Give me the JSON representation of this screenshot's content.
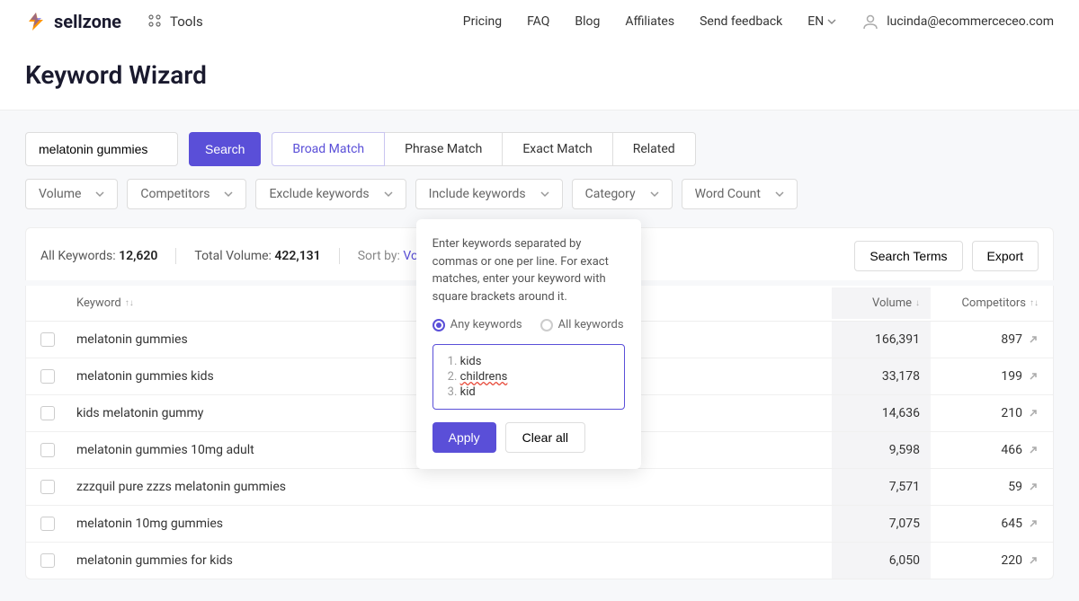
{
  "header": {
    "brand": "sellzone",
    "tools_label": "Tools",
    "nav": [
      "Pricing",
      "FAQ",
      "Blog",
      "Affiliates",
      "Send feedback"
    ],
    "lang": "EN",
    "user_email": "lucinda@ecommerceceo.com"
  },
  "page_title": "Keyword Wizard",
  "search": {
    "value": "melatonin gummies",
    "button": "Search"
  },
  "match_tabs": [
    "Broad Match",
    "Phrase Match",
    "Exact Match",
    "Related"
  ],
  "filters": {
    "volume": "Volume",
    "competitors": "Competitors",
    "exclude": "Exclude keywords",
    "include": "Include keywords",
    "category": "Category",
    "wordcount": "Word Count"
  },
  "stats": {
    "all_keywords_label": "All Keywords:",
    "all_keywords_value": "12,620",
    "total_volume_label": "Total Volume:",
    "total_volume_value": "422,131",
    "sortby_label": "Sort by:",
    "sortby_value": "Volum"
  },
  "actions": {
    "search_terms": "Search Terms",
    "export": "Export"
  },
  "table": {
    "headers": {
      "keyword": "Keyword",
      "volume": "Volume",
      "competitors": "Competitors"
    },
    "rows": [
      {
        "keyword": "melatonin gummies",
        "volume": "166,391",
        "competitors": "897"
      },
      {
        "keyword": "melatonin gummies kids",
        "volume": "33,178",
        "competitors": "199"
      },
      {
        "keyword": "kids melatonin gummy",
        "volume": "14,636",
        "competitors": "210"
      },
      {
        "keyword": "melatonin gummies 10mg adult",
        "volume": "9,598",
        "competitors": "466"
      },
      {
        "keyword": "zzzquil pure zzzs melatonin gummies",
        "volume": "7,571",
        "competitors": "59"
      },
      {
        "keyword": "melatonin 10mg gummies",
        "volume": "7,075",
        "competitors": "645"
      },
      {
        "keyword": "melatonin gummies for kids",
        "volume": "6,050",
        "competitors": "220"
      }
    ]
  },
  "popover": {
    "instructions": "Enter keywords separated by commas or one per line. For exact matches, enter your keyword with square brackets around it.",
    "radio_any": "Any keywords",
    "radio_all": "All keywords",
    "keywords": [
      "kids",
      "childrens",
      "kid"
    ],
    "apply": "Apply",
    "clear": "Clear all"
  }
}
